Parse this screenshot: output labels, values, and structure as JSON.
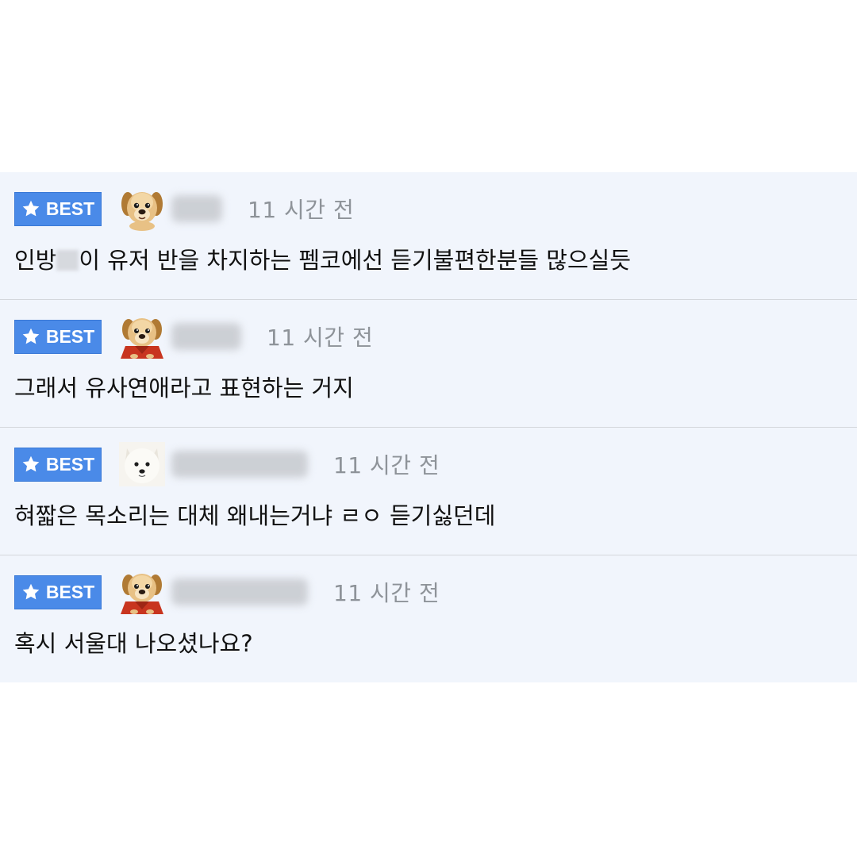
{
  "badge_label": "BEST",
  "colors": {
    "badge": "#4a8ae8",
    "row_background": "#f1f5fc",
    "time_text": "#8e9399"
  },
  "comments": [
    {
      "avatar_icon": "golden-puppy-icon",
      "time": "11 시간 전",
      "text_before": "인방",
      "text_after": "이 유저 반을 차지하는 펨코에선 듣기불편한분들 많으실듯"
    },
    {
      "avatar_icon": "puppy-red-scarf-icon",
      "time": "11 시간 전",
      "text": "그래서 유사연애라고 표현하는 거지"
    },
    {
      "avatar_icon": "white-samoyed-icon",
      "time": "11 시간 전",
      "text": "혀짧은 목소리는 대체 왜내는거냐 ㄹㅇ 듣기싫던데"
    },
    {
      "avatar_icon": "puppy-red-scarf-icon",
      "time": "11 시간 전",
      "text": "혹시 서울대 나오셨나요?"
    }
  ]
}
